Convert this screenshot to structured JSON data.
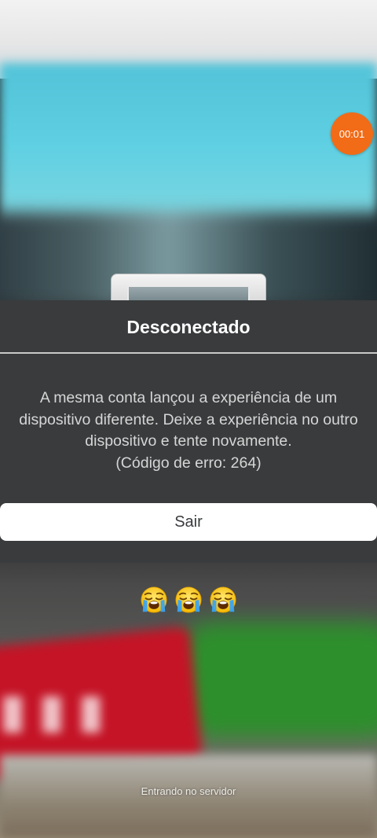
{
  "recording": {
    "timer": "00:01",
    "color": "#f26b17"
  },
  "dialog": {
    "title": "Desconectado",
    "message_lines": [
      "A mesma conta lançou a experiência de um",
      "dispositivo diferente. Deixe a experiência no outro",
      "dispositivo e tente novamente.",
      "(Código de erro: 264)"
    ],
    "exit_button_label": "Sair",
    "background_color": "#393b3d"
  },
  "reactions": {
    "emoji": "loudly-crying-face",
    "count": 3
  },
  "status": {
    "text": "Entrando no servidor"
  }
}
